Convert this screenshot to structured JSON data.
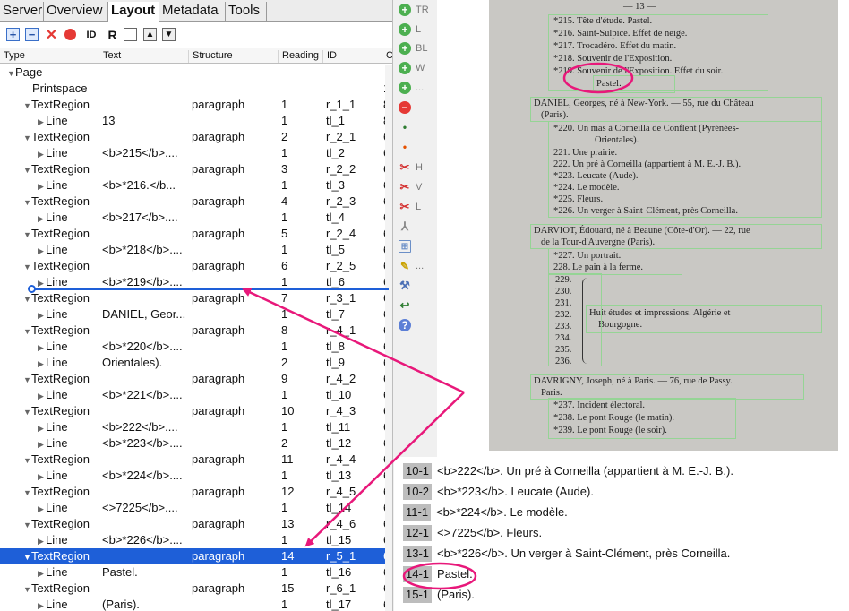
{
  "tabs": [
    "Server",
    "Overview",
    "Layout",
    "Metadata",
    "Tools"
  ],
  "active_tab": "Layout",
  "toolbar_icons": [
    "expand-all-icon",
    "collapse-all-icon",
    "delete-icon",
    "remove-icon",
    "id-icon",
    "reading-order-icon",
    "layout-icon",
    "move-up-icon",
    "move-down-icon"
  ],
  "toolbar_text": {
    "id": "ID",
    "r": "R"
  },
  "columns": [
    "Type",
    "Text",
    "Structure",
    "Reading",
    "ID",
    "C"
  ],
  "tree_rows": [
    {
      "indent": 0,
      "tri": "▼",
      "type": "Page",
      "text": "",
      "structure": "",
      "reading": "",
      "id": "",
      "extra": ""
    },
    {
      "indent": 2,
      "tri": "",
      "type": "Printspace",
      "text": "",
      "structure": "",
      "reading": "",
      "id": "",
      "extra": "1"
    },
    {
      "indent": 1,
      "tri": "▼",
      "type": "TextRegion",
      "text": "",
      "structure": "paragraph",
      "reading": "1",
      "id": "r_1_1",
      "extra": "8"
    },
    {
      "indent": 2,
      "tri": "▶",
      "type": "Line",
      "text": "13",
      "structure": "",
      "reading": "1",
      "id": "tl_1",
      "extra": "8"
    },
    {
      "indent": 1,
      "tri": "▼",
      "type": "TextRegion",
      "text": "",
      "structure": "paragraph",
      "reading": "2",
      "id": "r_2_1",
      "extra": "6"
    },
    {
      "indent": 2,
      "tri": "▶",
      "type": "Line",
      "text": "<b>215</b>....",
      "structure": "",
      "reading": "1",
      "id": "tl_2",
      "extra": "6"
    },
    {
      "indent": 1,
      "tri": "▼",
      "type": "TextRegion",
      "text": "",
      "structure": "paragraph",
      "reading": "3",
      "id": "r_2_2",
      "extra": "6"
    },
    {
      "indent": 2,
      "tri": "▶",
      "type": "Line",
      "text": "<b>*216.</b...",
      "structure": "",
      "reading": "1",
      "id": "tl_3",
      "extra": "6"
    },
    {
      "indent": 1,
      "tri": "▼",
      "type": "TextRegion",
      "text": "",
      "structure": "paragraph",
      "reading": "4",
      "id": "r_2_3",
      "extra": "6"
    },
    {
      "indent": 2,
      "tri": "▶",
      "type": "Line",
      "text": "<b>217</b>....",
      "structure": "",
      "reading": "1",
      "id": "tl_4",
      "extra": "6"
    },
    {
      "indent": 1,
      "tri": "▼",
      "type": "TextRegion",
      "text": "",
      "structure": "paragraph",
      "reading": "5",
      "id": "r_2_4",
      "extra": "6"
    },
    {
      "indent": 2,
      "tri": "▶",
      "type": "Line",
      "text": "<b>*218</b>....",
      "structure": "",
      "reading": "1",
      "id": "tl_5",
      "extra": "6"
    },
    {
      "indent": 1,
      "tri": "▼",
      "type": "TextRegion",
      "text": "",
      "structure": "paragraph",
      "reading": "6",
      "id": "r_2_5",
      "extra": "6"
    },
    {
      "indent": 2,
      "tri": "▶",
      "type": "Line",
      "text": "<b>*219</b>....",
      "structure": "",
      "reading": "1",
      "id": "tl_6",
      "extra": "6"
    },
    {
      "indent": 1,
      "tri": "▼",
      "type": "TextRegion",
      "text": "",
      "structure": "paragraph",
      "reading": "7",
      "id": "r_3_1",
      "extra": "6"
    },
    {
      "indent": 2,
      "tri": "▶",
      "type": "Line",
      "text": "DANIEL, Geor...",
      "structure": "",
      "reading": "1",
      "id": "tl_7",
      "extra": "6"
    },
    {
      "indent": 1,
      "tri": "▼",
      "type": "TextRegion",
      "text": "",
      "structure": "paragraph",
      "reading": "8",
      "id": "r_4_1",
      "extra": "6"
    },
    {
      "indent": 2,
      "tri": "▶",
      "type": "Line",
      "text": "<b>*220</b>....",
      "structure": "",
      "reading": "1",
      "id": "tl_8",
      "extra": "6"
    },
    {
      "indent": 2,
      "tri": "▶",
      "type": "Line",
      "text": "Orientales).",
      "structure": "",
      "reading": "2",
      "id": "tl_9",
      "extra": "6"
    },
    {
      "indent": 1,
      "tri": "▼",
      "type": "TextRegion",
      "text": "",
      "structure": "paragraph",
      "reading": "9",
      "id": "r_4_2",
      "extra": "6"
    },
    {
      "indent": 2,
      "tri": "▶",
      "type": "Line",
      "text": "<b>*221</b>....",
      "structure": "",
      "reading": "1",
      "id": "tl_10",
      "extra": "6"
    },
    {
      "indent": 1,
      "tri": "▼",
      "type": "TextRegion",
      "text": "",
      "structure": "paragraph",
      "reading": "10",
      "id": "r_4_3",
      "extra": "6"
    },
    {
      "indent": 2,
      "tri": "▶",
      "type": "Line",
      "text": "<b>222</b>....",
      "structure": "",
      "reading": "1",
      "id": "tl_11",
      "extra": "6"
    },
    {
      "indent": 2,
      "tri": "▶",
      "type": "Line",
      "text": "<b>*223</b>....",
      "structure": "",
      "reading": "2",
      "id": "tl_12",
      "extra": "6"
    },
    {
      "indent": 1,
      "tri": "▼",
      "type": "TextRegion",
      "text": "",
      "structure": "paragraph",
      "reading": "11",
      "id": "r_4_4",
      "extra": "6"
    },
    {
      "indent": 2,
      "tri": "▶",
      "type": "Line",
      "text": "<b>*224</b>....",
      "structure": "",
      "reading": "1",
      "id": "tl_13",
      "extra": "6"
    },
    {
      "indent": 1,
      "tri": "▼",
      "type": "TextRegion",
      "text": "",
      "structure": "paragraph",
      "reading": "12",
      "id": "r_4_5",
      "extra": "6"
    },
    {
      "indent": 2,
      "tri": "▶",
      "type": "Line",
      "text": "<>7225</b>....",
      "structure": "",
      "reading": "1",
      "id": "tl_14",
      "extra": "6"
    },
    {
      "indent": 1,
      "tri": "▼",
      "type": "TextRegion",
      "text": "",
      "structure": "paragraph",
      "reading": "13",
      "id": "r_4_6",
      "extra": "6"
    },
    {
      "indent": 2,
      "tri": "▶",
      "type": "Line",
      "text": "<b>*226</b>....",
      "structure": "",
      "reading": "1",
      "id": "tl_15",
      "extra": "6"
    },
    {
      "indent": 1,
      "tri": "▼",
      "type": "TextRegion",
      "text": "",
      "structure": "paragraph",
      "reading": "14",
      "id": "r_5_1",
      "extra": "6",
      "selected": true
    },
    {
      "indent": 2,
      "tri": "▶",
      "type": "Line",
      "text": "Pastel.",
      "structure": "",
      "reading": "1",
      "id": "tl_16",
      "extra": "6"
    },
    {
      "indent": 1,
      "tri": "▼",
      "type": "TextRegion",
      "text": "",
      "structure": "paragraph",
      "reading": "15",
      "id": "r_6_1",
      "extra": "6"
    },
    {
      "indent": 2,
      "tri": "▶",
      "type": "Line",
      "text": "(Paris).",
      "structure": "",
      "reading": "1",
      "id": "tl_17",
      "extra": "6"
    }
  ],
  "side_tools": [
    {
      "icon": "add-icon",
      "label": "TR"
    },
    {
      "icon": "add-icon",
      "label": "L"
    },
    {
      "icon": "add-icon",
      "label": "BL"
    },
    {
      "icon": "add-icon",
      "label": "W"
    },
    {
      "icon": "add-icon",
      "label": "..."
    },
    {
      "icon": "remove-icon",
      "label": ""
    },
    {
      "icon": "add-point-icon",
      "label": ""
    },
    {
      "icon": "remove-point-icon",
      "label": ""
    },
    {
      "icon": "split-icon",
      "label": "H"
    },
    {
      "icon": "split-icon",
      "label": "V"
    },
    {
      "icon": "split-icon",
      "label": "L"
    },
    {
      "icon": "merge-icon",
      "label": ""
    },
    {
      "icon": "table-icon",
      "label": ""
    },
    {
      "icon": "edit-icon",
      "label": "..."
    },
    {
      "icon": "wrench-icon",
      "label": ""
    },
    {
      "icon": "undo-icon",
      "label": ""
    },
    {
      "icon": "help-icon",
      "label": ""
    }
  ],
  "doc_lines": [
    "— 13 —",
    "*215. Tête d'étude. Pastel.",
    "*216. Saint-Sulpice. Effet de neige.",
    "*217. Trocadéro. Effet du matin.",
    "*218. Souvenir de l'Exposition.",
    "*219. Souvenir de l'Exposition. Effet du soir.",
    "Pastel.",
    "DANIEL, Georges, né à New-York. — 55, rue du Château",
    "(Paris).",
    "*220. Un mas à Corneilla de Conflent (Pyrénées-",
    "Orientales).",
    "221. Une prairie.",
    "222. Un pré à Corneilla (appartient à M. E.-J. B.).",
    "*223. Leucate (Aude).",
    "*224. Le modèle.",
    "*225. Fleurs.",
    "*226. Un verger à Saint-Clément, près Corneilla.",
    "DARVIOT, Édouard, né à Beaune (Côte-d'Or). — 22, rue",
    "de la Tour-d'Auvergne (Paris).",
    "*227. Un portrait.",
    "228. Le pain à la ferme.",
    "229.",
    "230.",
    "231.",
    "232.",
    "233.",
    "234.",
    "235.",
    "236.",
    "Huit études et impressions. Algérie et",
    "Bourgogne.",
    "DAVRIGNY, Joseph, né à Paris. — 76, rue de Passy.",
    "Paris.",
    "*237. Incident électoral.",
    "*238. Le pont Rouge (le matin).",
    "*239. Le pont Rouge (le soir)."
  ],
  "transcription": [
    {
      "badge": "10-1",
      "text": "<b>222</b>. Un pré à Corneilla (appartient à M. E.-J. B.)."
    },
    {
      "badge": "10-2",
      "text": "<b>*223</b>. Leucate (Aude)."
    },
    {
      "badge": "11-1",
      "text": "<b>*224</b>. Le modèle."
    },
    {
      "badge": "12-1",
      "text": "<>7225</b>. Fleurs."
    },
    {
      "badge": "13-1",
      "text": "<b>*226</b>. Un verger à Saint-Clément, près Corneilla."
    },
    {
      "badge": "14-1",
      "text": "Pastel."
    },
    {
      "badge": "15-1",
      "text": "(Paris)."
    }
  ],
  "colors": {
    "selection": "#1e5fd8",
    "annotation": "#e8187a",
    "region_box": "#95d495"
  }
}
